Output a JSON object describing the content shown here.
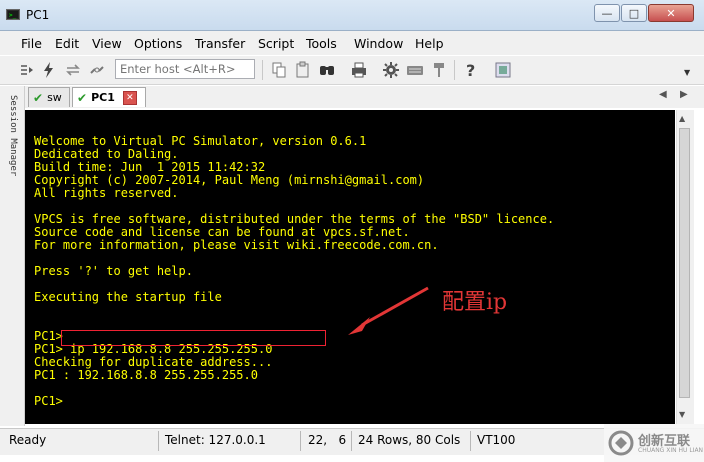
{
  "window": {
    "title": "PC1"
  },
  "menu": [
    "File",
    "Edit",
    "View",
    "Options",
    "Transfer",
    "Script",
    "Tools",
    "Window",
    "Help"
  ],
  "toolbar": {
    "host_placeholder": "Enter host <Alt+R>"
  },
  "session_manager": {
    "label": "Session Manager"
  },
  "tabs": [
    {
      "label": "sw",
      "status_color": "#2d9a2d"
    },
    {
      "label": "PC1",
      "status_color": "#2d9a2d",
      "active": true
    }
  ],
  "terminal": {
    "text_color": "#ffff00",
    "background": "#000000",
    "lines": [
      "",
      "Welcome to Virtual PC Simulator, version 0.6.1",
      "Dedicated to Daling.",
      "Build time: Jun  1 2015 11:42:32",
      "Copyright (c) 2007-2014, Paul Meng (mirnshi@gmail.com)",
      "All rights reserved.",
      "",
      "VPCS is free software, distributed under the terms of the \"BSD\" licence.",
      "Source code and license can be found at vpcs.sf.net.",
      "For more information, please visit wiki.freecode.com.cn.",
      "",
      "Press '?' to get help.",
      "",
      "Executing the startup file",
      "",
      "",
      "PC1>",
      "PC1> ip 192.168.8.8 255.255.255.0",
      "Checking for duplicate address...",
      "PC1 : 192.168.8.8 255.255.255.0",
      "",
      "PC1>"
    ]
  },
  "annotation": {
    "text": "配置ip",
    "color": "#e23636"
  },
  "status": {
    "ready": "Ready",
    "connection": "Telnet: 127.0.0.1",
    "cursor": "22,   6",
    "size": "24 Rows, 80 Cols",
    "terminal_type": "VT100"
  },
  "watermark": {
    "text": "创新互联",
    "subtext": "CHUANG XIN HU LIAN"
  },
  "icons": [
    "connect-icon",
    "quick-connect-icon",
    "reconnect-icon",
    "disconnect-icon",
    "copy-icon",
    "paste-icon",
    "find-icon",
    "print-icon",
    "settings-icon",
    "keymap-icon",
    "sftp-icon",
    "help-icon",
    "screen-icon"
  ]
}
